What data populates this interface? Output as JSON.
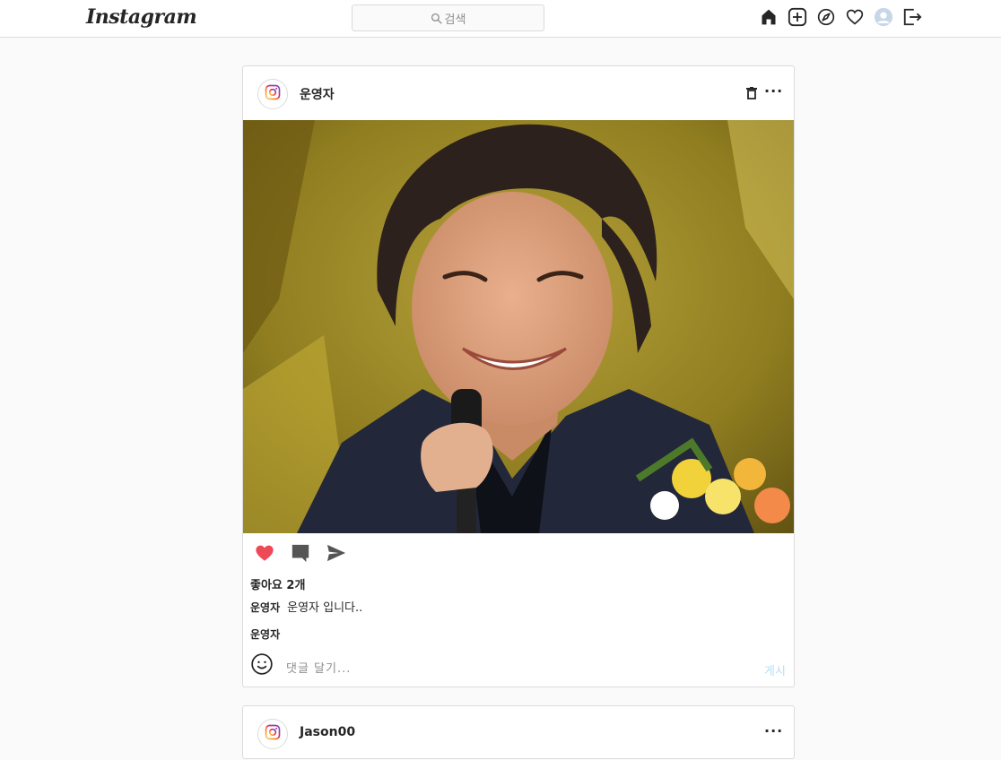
{
  "header": {
    "logo": "Instagram",
    "search_placeholder": "검색",
    "icons": [
      "home-icon",
      "new-post-icon",
      "explore-icon",
      "activity-heart-icon",
      "profile-avatar-icon",
      "logout-icon"
    ]
  },
  "colors": {
    "liked": "#ed4956",
    "post_button": "#b2dffc",
    "border": "#dbdbdb",
    "background": "#fafafa"
  },
  "posts": [
    {
      "username": "운영자",
      "likes": "좋아요 2개",
      "caption_user": "운영자",
      "caption_text": "운영자 입니다..",
      "comment_user": "운영자",
      "comment_placeholder": "댓글 달기...",
      "post_button": "게시",
      "liked": true
    },
    {
      "username": "Jason00"
    }
  ]
}
